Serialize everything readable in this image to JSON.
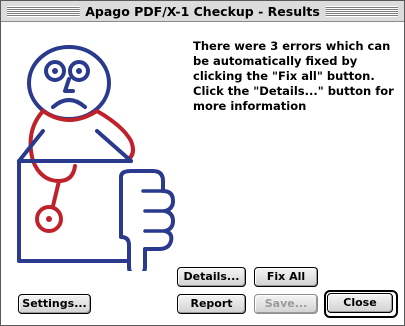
{
  "window": {
    "title": "Apago PDF/X-1 Checkup - Results"
  },
  "message": {
    "text": "There were 3 errors which can be automatically fixed by clicking the \"Fix all\" button.  Click the \"Details...\" button for more information"
  },
  "illustration": {
    "icon_name": "doctor-thumbs-down-icon",
    "stroke_color": "#2a3a8c",
    "accent_color": "#c0222b"
  },
  "buttons": {
    "details": "Details...",
    "fix_all": "Fix All",
    "settings": "Settings...",
    "report": "Report",
    "save": "Save...",
    "close": "Close"
  }
}
